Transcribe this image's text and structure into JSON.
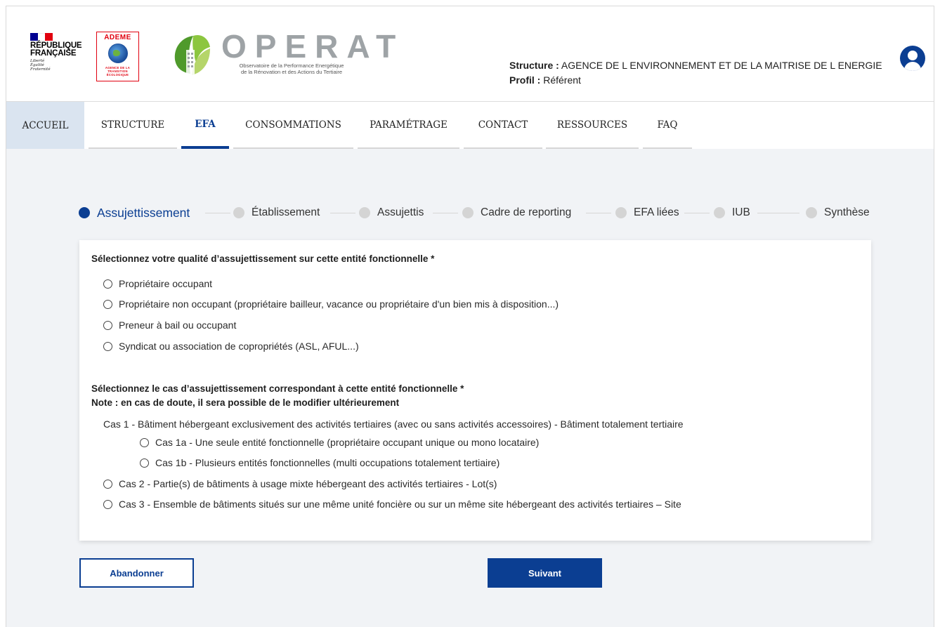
{
  "header": {
    "rf": {
      "flag_colors": [
        "#000091",
        "#ffffff",
        "#e1000f"
      ],
      "name_line1": "RÉPUBLIQUE",
      "name_line2": "FRANÇAISE",
      "motto_line1": "Liberté",
      "motto_line2": "Égalité",
      "motto_line3": "Fraternité"
    },
    "ademe": {
      "title": "ADEME",
      "subtitle_line1": "AGENCE DE LA",
      "subtitle_line2": "TRANSITION",
      "subtitle_line3": "ÉCOLOGIQUE"
    },
    "operat": {
      "wordmark": "OPERAT",
      "tagline_line1": "Observatoire de la Performance Energétique",
      "tagline_line2": "de la Rénovation et des Actions du Tertiaire"
    },
    "user": {
      "structure_label": "Structure :",
      "structure_value": "AGENCE DE L ENVIRONNEMENT ET DE LA MAITRISE DE L ENERGIE",
      "profile_label": "Profil :",
      "profile_value": "Référent"
    },
    "avatar_icon": "user-circle-icon"
  },
  "nav": {
    "items": [
      {
        "label": "ACCUEIL"
      },
      {
        "label": "STRUCTURE"
      },
      {
        "label": "EFA"
      },
      {
        "label": "CONSOMMATIONS"
      },
      {
        "label": "PARAMÉTRAGE"
      },
      {
        "label": "CONTACT"
      },
      {
        "label": "RESSOURCES"
      },
      {
        "label": "FAQ"
      }
    ],
    "active": "EFA"
  },
  "stepper": {
    "steps": [
      {
        "label": "Assujettissement"
      },
      {
        "label": "Établissement"
      },
      {
        "label": "Assujettis"
      },
      {
        "label": "Cadre de reporting"
      },
      {
        "label": "EFA liées"
      },
      {
        "label": "IUB"
      },
      {
        "label": "Synthèse"
      }
    ],
    "current": "Assujettissement"
  },
  "form": {
    "q1_title": "Sélectionnez votre qualité d’assujettissement sur cette entité fonctionnelle *",
    "q1_options": [
      {
        "label": "Propriétaire occupant"
      },
      {
        "label": "Propriétaire non occupant (propriétaire bailleur, vacance ou propriétaire d'un bien mis à disposition...)"
      },
      {
        "label": "Preneur à bail ou occupant"
      },
      {
        "label": "Syndicat ou association de copropriétés (ASL, AFUL...)"
      }
    ],
    "q2_title": "Sélectionnez le cas d’assujettissement correspondant à cette entité fonctionnelle *",
    "q2_note": "Note : en cas de doute, il sera possible de le modifier ultérieurement",
    "case1": {
      "prefix": "Cas 1 -",
      "text": " Bâtiment hébergeant exclusivement des activités tertiaires (avec ou sans activités accessoires) ",
      "dash": "-",
      "suffix": " Bâtiment totalement tertiaire"
    },
    "case1a": {
      "prefix": "Cas 1a -",
      "text": " Une seule entité fonctionnelle (propriétaire occupant unique ou mono locataire)"
    },
    "case1b": {
      "prefix": "Cas 1b -",
      "text": " Plusieurs entités fonctionnelles (multi occupations totalement tertiaire)"
    },
    "case2": {
      "prefix": "Cas 2 -",
      "text": " Partie(s) de bâtiments à usage mixte hébergeant des activités tertiaires ",
      "dash": "-",
      "suffix": " Lot(s)"
    },
    "case3": {
      "prefix": "Cas 3 -",
      "text": " Ensemble de bâtiments situés sur une même unité foncière ou sur un même site hébergeant des activités tertiaires – Site"
    }
  },
  "actions": {
    "abandon_label": "Abandonner",
    "next_label": "Suivant"
  }
}
